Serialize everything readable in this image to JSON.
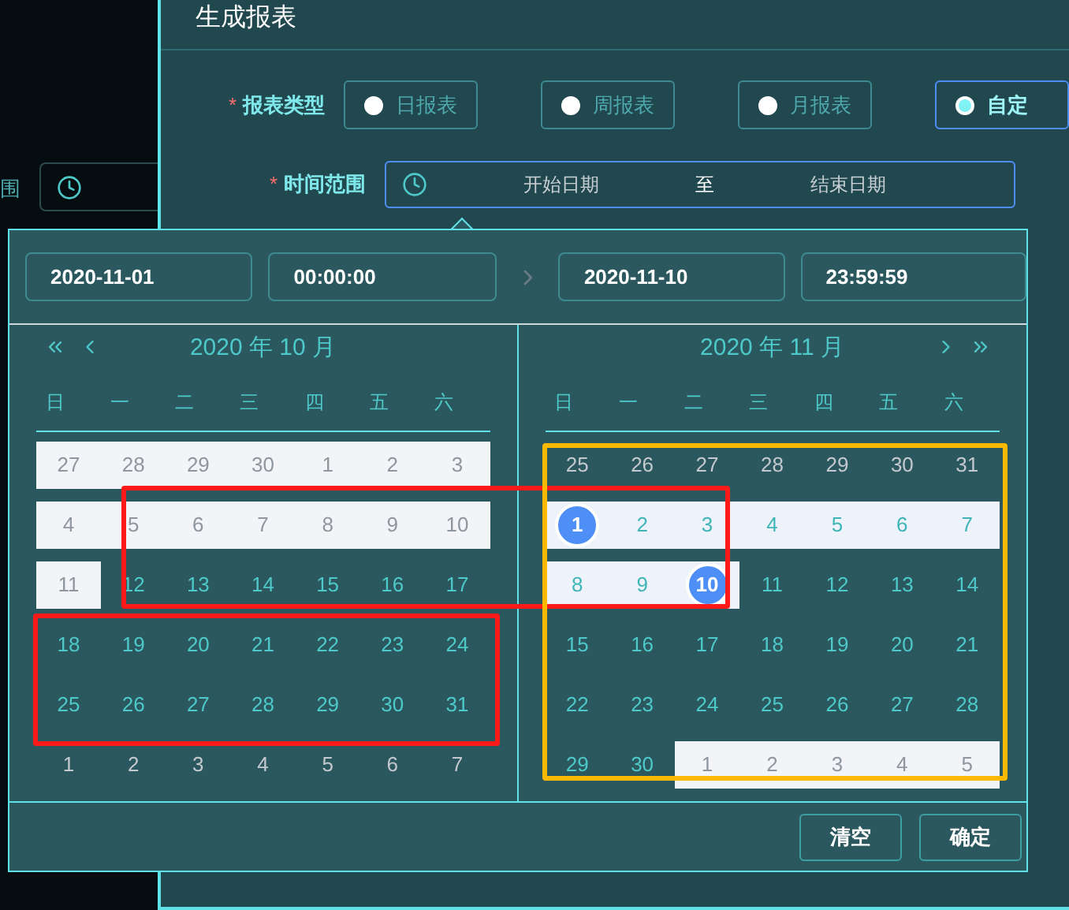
{
  "background": {
    "label": "围"
  },
  "required_marker": "*",
  "dialog": {
    "title": "生成报表",
    "fields": [
      {
        "kind": "radio",
        "label": "报表类型",
        "required": true,
        "options": [
          {
            "label": "日报表",
            "selected": false
          },
          {
            "label": "周报表",
            "selected": false
          },
          {
            "label": "月报表",
            "selected": false
          },
          {
            "label": "自定",
            "selected": true
          }
        ]
      },
      {
        "kind": "range",
        "label": "时间范围",
        "required": true,
        "start_placeholder": "开始日期",
        "separator": "至",
        "end_placeholder": "结束日期"
      }
    ]
  },
  "picker": {
    "start_date": "2020-11-01",
    "start_time": "00:00:00",
    "end_date": "2020-11-10",
    "end_time": "23:59:59",
    "calendars": [
      {
        "title": "2020 年 10 月",
        "weekdays": [
          "日",
          "一",
          "二",
          "三",
          "四",
          "五",
          "六"
        ],
        "days": [
          {
            "text": "27",
            "kind": "disabled"
          },
          {
            "text": "28",
            "kind": "disabled"
          },
          {
            "text": "29",
            "kind": "disabled"
          },
          {
            "text": "30",
            "kind": "disabled"
          },
          {
            "text": "1",
            "kind": "disabled"
          },
          {
            "text": "2",
            "kind": "disabled"
          },
          {
            "text": "3",
            "kind": "disabled"
          },
          {
            "text": "4",
            "kind": "disabled"
          },
          {
            "text": "5",
            "kind": "disabled"
          },
          {
            "text": "6",
            "kind": "disabled"
          },
          {
            "text": "7",
            "kind": "disabled"
          },
          {
            "text": "8",
            "kind": "disabled"
          },
          {
            "text": "9",
            "kind": "disabled"
          },
          {
            "text": "10",
            "kind": "disabled"
          },
          {
            "text": "11",
            "kind": "disabled"
          },
          {
            "text": "12",
            "kind": "normal"
          },
          {
            "text": "13",
            "kind": "normal"
          },
          {
            "text": "14",
            "kind": "normal"
          },
          {
            "text": "15",
            "kind": "normal"
          },
          {
            "text": "16",
            "kind": "normal"
          },
          {
            "text": "17",
            "kind": "normal"
          },
          {
            "text": "18",
            "kind": "normal"
          },
          {
            "text": "19",
            "kind": "normal"
          },
          {
            "text": "20",
            "kind": "normal"
          },
          {
            "text": "21",
            "kind": "normal"
          },
          {
            "text": "22",
            "kind": "normal"
          },
          {
            "text": "23",
            "kind": "normal"
          },
          {
            "text": "24",
            "kind": "normal"
          },
          {
            "text": "25",
            "kind": "normal"
          },
          {
            "text": "26",
            "kind": "normal"
          },
          {
            "text": "27",
            "kind": "normal"
          },
          {
            "text": "28",
            "kind": "normal"
          },
          {
            "text": "29",
            "kind": "normal"
          },
          {
            "text": "30",
            "kind": "normal"
          },
          {
            "text": "31",
            "kind": "normal"
          },
          {
            "text": "1",
            "kind": "other"
          },
          {
            "text": "2",
            "kind": "other"
          },
          {
            "text": "3",
            "kind": "other"
          },
          {
            "text": "4",
            "kind": "other"
          },
          {
            "text": "5",
            "kind": "other"
          },
          {
            "text": "6",
            "kind": "other"
          },
          {
            "text": "7",
            "kind": "other"
          }
        ]
      },
      {
        "title": "2020 年 11 月",
        "weekdays": [
          "日",
          "一",
          "二",
          "三",
          "四",
          "五",
          "六"
        ],
        "days": [
          {
            "text": "25",
            "kind": "other"
          },
          {
            "text": "26",
            "kind": "other"
          },
          {
            "text": "27",
            "kind": "other"
          },
          {
            "text": "28",
            "kind": "other"
          },
          {
            "text": "29",
            "kind": "other"
          },
          {
            "text": "30",
            "kind": "other"
          },
          {
            "text": "31",
            "kind": "other"
          },
          {
            "text": "1",
            "kind": "endpoint"
          },
          {
            "text": "2",
            "kind": "in_range"
          },
          {
            "text": "3",
            "kind": "in_range"
          },
          {
            "text": "4",
            "kind": "in_range"
          },
          {
            "text": "5",
            "kind": "in_range"
          },
          {
            "text": "6",
            "kind": "in_range"
          },
          {
            "text": "7",
            "kind": "in_range"
          },
          {
            "text": "8",
            "kind": "in_range"
          },
          {
            "text": "9",
            "kind": "in_range"
          },
          {
            "text": "10",
            "kind": "endpoint"
          },
          {
            "text": "11",
            "kind": "normal"
          },
          {
            "text": "12",
            "kind": "normal"
          },
          {
            "text": "13",
            "kind": "normal"
          },
          {
            "text": "14",
            "kind": "normal"
          },
          {
            "text": "15",
            "kind": "normal"
          },
          {
            "text": "16",
            "kind": "normal"
          },
          {
            "text": "17",
            "kind": "normal"
          },
          {
            "text": "18",
            "kind": "normal"
          },
          {
            "text": "19",
            "kind": "normal"
          },
          {
            "text": "20",
            "kind": "normal"
          },
          {
            "text": "21",
            "kind": "normal"
          },
          {
            "text": "22",
            "kind": "normal"
          },
          {
            "text": "23",
            "kind": "normal"
          },
          {
            "text": "24",
            "kind": "normal"
          },
          {
            "text": "25",
            "kind": "normal"
          },
          {
            "text": "26",
            "kind": "normal"
          },
          {
            "text": "27",
            "kind": "normal"
          },
          {
            "text": "28",
            "kind": "normal"
          },
          {
            "text": "29",
            "kind": "normal"
          },
          {
            "text": "30",
            "kind": "normal"
          },
          {
            "text": "1",
            "kind": "disabled"
          },
          {
            "text": "2",
            "kind": "disabled"
          },
          {
            "text": "3",
            "kind": "disabled"
          },
          {
            "text": "4",
            "kind": "disabled"
          },
          {
            "text": "5",
            "kind": "disabled"
          }
        ]
      }
    ],
    "buttons": [
      "清空",
      "确定"
    ]
  },
  "annotations": [
    {
      "color": "#ff1a1a"
    },
    {
      "color": "#ff1a1a"
    },
    {
      "color": "#ffb800"
    }
  ]
}
